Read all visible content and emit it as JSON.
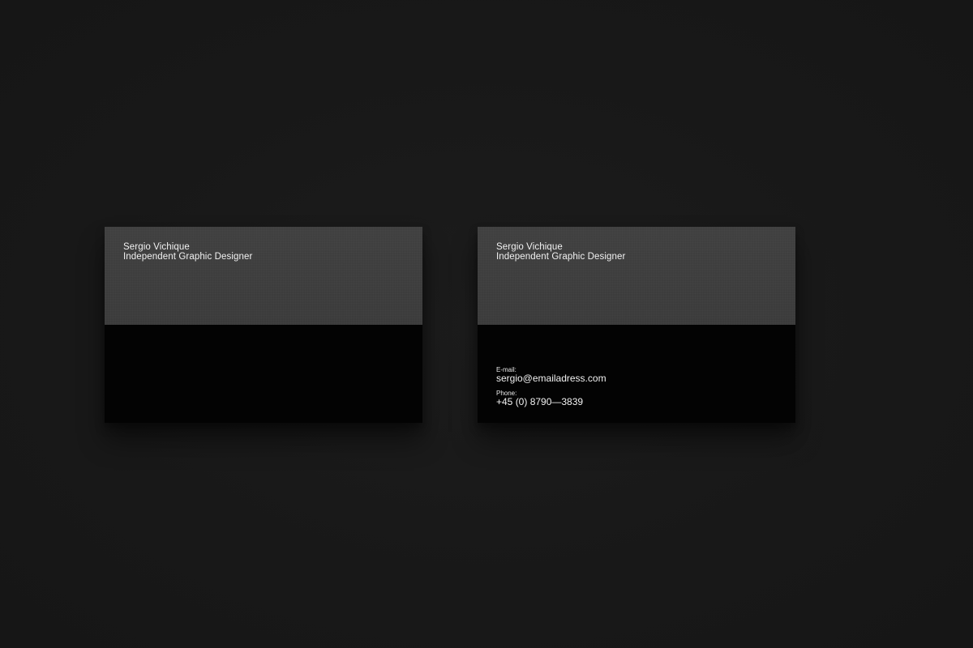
{
  "cards": {
    "front": {
      "name": "Sergio Vichique",
      "title": "Independent Graphic Designer"
    },
    "back": {
      "name": "Sergio Vichique",
      "title": "Independent Graphic Designer",
      "email_label": "E-mail:",
      "email": "sergio@emailadress.com",
      "phone_label": "Phone:",
      "phone": "+45 (0) 8790—3839"
    }
  },
  "colors": {
    "background": "#181818",
    "card_top": "#3d3d3d",
    "card_bottom": "#030303",
    "text": "#f2f2f2"
  }
}
